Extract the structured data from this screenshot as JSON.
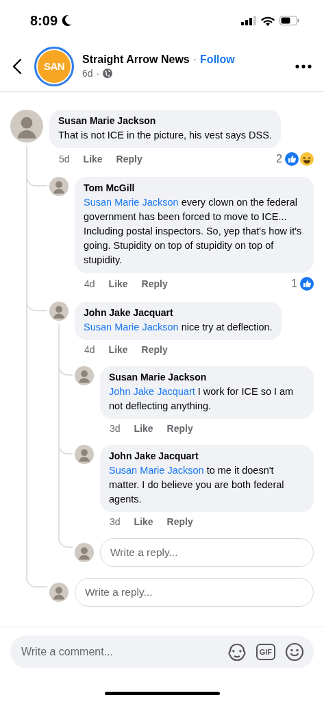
{
  "status_bar": {
    "time": "8:09"
  },
  "header": {
    "logo_text": "SAN",
    "page_name": "Straight Arrow News",
    "separator": "·",
    "follow": "Follow",
    "age": "6d",
    "age_separator": "·"
  },
  "comments": [
    {
      "author": "Susan Marie Jackson",
      "text": "That is not ICE in the picture, his vest says DSS.",
      "age": "5d",
      "like_label": "Like",
      "reply_label": "Reply",
      "reaction_count": "2",
      "reactions": [
        {
          "kind": "like"
        },
        {
          "kind": "haha"
        }
      ],
      "children": [
        {
          "author": "Tom McGill",
          "mention": "Susan Marie Jackson",
          "text": "every clown on the federal government has been forced to move to ICE... Including postal inspectors. So, yep that's how it's going. Stupidity on top of stupidity on top of stupidity.",
          "age": "4d",
          "like_label": "Like",
          "reply_label": "Reply",
          "reaction_count": "1",
          "reactions": [
            {
              "kind": "like"
            }
          ]
        },
        {
          "author": "John Jake Jacquart",
          "mention": "Susan Marie Jackson",
          "text": "nice try at deflection.",
          "age": "4d",
          "like_label": "Like",
          "reply_label": "Reply",
          "children": [
            {
              "author": "Susan Marie Jackson",
              "mention": "John Jake Jacquart",
              "text": "I work for ICE so I am not deflecting anything.",
              "age": "3d",
              "like_label": "Like",
              "reply_label": "Reply"
            },
            {
              "author": "John Jake Jacquart",
              "mention": "Susan Marie Jackson",
              "text": "to me it doesn't matter.  I do believe you are both federal agents.",
              "age": "3d",
              "like_label": "Like",
              "reply_label": "Reply"
            }
          ],
          "reply_box": {
            "placeholder": "Write a reply..."
          }
        }
      ],
      "reply_box": {
        "placeholder": "Write a reply..."
      }
    }
  ],
  "composer": {
    "placeholder": "Write a comment...",
    "gif_label": "GIF"
  }
}
